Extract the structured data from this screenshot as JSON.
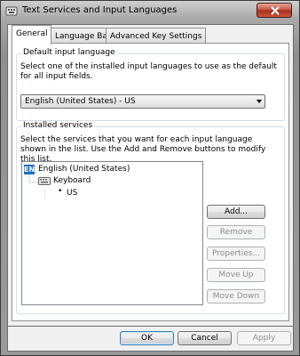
{
  "window": {
    "title": "Text Services and Input Languages",
    "close_icon": "close-x-icon"
  },
  "tabs": [
    {
      "label": "General",
      "active": true
    },
    {
      "label": "Language Bar",
      "active": false
    },
    {
      "label": "Advanced Key Settings",
      "active": false
    }
  ],
  "default_input": {
    "group_label": "Default input language",
    "description": "Select one of the installed input languages to use as the default for all input fields.",
    "selected_value": "English (United States) - US"
  },
  "installed_services": {
    "group_label": "Installed services",
    "description": "Select the services that you want for each input language shown in the list. Use the Add and Remove buttons to modify this list.",
    "tree": {
      "language_badge": "EN",
      "language": "English (United States)",
      "category": "Keyboard",
      "layout": "US"
    },
    "buttons": {
      "add": "Add...",
      "remove": "Remove",
      "properties": "Properties...",
      "move_up": "Move Up",
      "move_down": "Move Down"
    }
  },
  "footer": {
    "ok": "OK",
    "cancel": "Cancel",
    "apply": "Apply"
  }
}
